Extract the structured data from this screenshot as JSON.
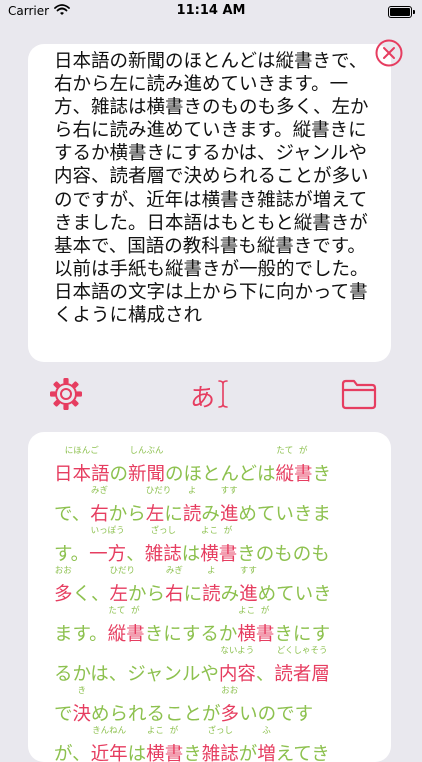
{
  "status_bar": {
    "carrier": "Carrier",
    "time": "11:14 AM"
  },
  "input": {
    "text": "日本語の新聞のほとんどは縦書きで、右から左に読み進めていきます。一方、雑誌は横書きのものも多く、左から右に読み進めていきます。縦書きにするか横書きにするかは、ジャンルや内容、読者層で決められることが多いのですが、近年は横書き雑誌が増えてきました。日本語はもともと縦書きが基本で、国語の教科書も縦書きです。以前は手紙も縦書きが一般的でした。日本語の文字は上から下に向かって書くように構成され"
  },
  "toolbar": {
    "mode_glyph": "あ"
  },
  "icons": {
    "close": "close-circle-icon",
    "settings": "gear-icon",
    "mode": "hiragana-text-cursor-icon",
    "files": "folder-icon"
  },
  "colors": {
    "accent": "#e63d60",
    "kana": "#8dc14f",
    "background": "#e9e8ee"
  },
  "output": {
    "lines": [
      [
        {
          "t": "日本語",
          "r": "にほんご"
        },
        {
          "t": "の"
        },
        {
          "t": "新聞",
          "r": "しんぶん"
        },
        {
          "t": "のほとんどは"
        },
        {
          "t": "縦",
          "r": "たて"
        },
        {
          "t": "書",
          "r": "が"
        },
        {
          "t": "き"
        }
      ],
      [
        {
          "t": "で、"
        },
        {
          "t": "右",
          "r": "みぎ"
        },
        {
          "t": "から"
        },
        {
          "t": "左",
          "r": "ひだり"
        },
        {
          "t": "に"
        },
        {
          "t": "読",
          "r": "よ"
        },
        {
          "t": "み"
        },
        {
          "t": "進",
          "r": "すす"
        },
        {
          "t": "めていきま"
        }
      ],
      [
        {
          "t": "す。"
        },
        {
          "t": "一方",
          "r": "いっぽう"
        },
        {
          "t": "、"
        },
        {
          "t": "雑誌",
          "r": "ざっし"
        },
        {
          "t": "は"
        },
        {
          "t": "横",
          "r": "よこ"
        },
        {
          "t": "書",
          "r": "が"
        },
        {
          "t": "きのものも"
        }
      ],
      [
        {
          "t": "多",
          "r": "おお"
        },
        {
          "t": "く、"
        },
        {
          "t": "左",
          "r": "ひだり"
        },
        {
          "t": "から"
        },
        {
          "t": "右",
          "r": "みぎ"
        },
        {
          "t": "に"
        },
        {
          "t": "読",
          "r": "よ"
        },
        {
          "t": "み"
        },
        {
          "t": "進",
          "r": "すす"
        },
        {
          "t": "めていき"
        }
      ],
      [
        {
          "t": "ます。"
        },
        {
          "t": "縦",
          "r": "たて"
        },
        {
          "t": "書",
          "r": "が"
        },
        {
          "t": "きにするか"
        },
        {
          "t": "横",
          "r": "よこ"
        },
        {
          "t": "書",
          "r": "が"
        },
        {
          "t": "きにす"
        }
      ],
      [
        {
          "t": "るかは、ジャンルや"
        },
        {
          "t": "内容",
          "r": "ないよう"
        },
        {
          "t": "、"
        },
        {
          "t": "読者層",
          "r": "どくしゃそう"
        }
      ],
      [
        {
          "t": "で"
        },
        {
          "t": "決",
          "r": "き"
        },
        {
          "t": "められることが"
        },
        {
          "t": "多",
          "r": "おお"
        },
        {
          "t": "いのです"
        }
      ],
      [
        {
          "t": "が、"
        },
        {
          "t": "近年",
          "r": "きんねん"
        },
        {
          "t": "は"
        },
        {
          "t": "横",
          "r": "よこ"
        },
        {
          "t": "書",
          "r": "が"
        },
        {
          "t": "き"
        },
        {
          "t": "雑誌",
          "r": "ざっし"
        },
        {
          "t": "が"
        },
        {
          "t": "増",
          "r": "ふ"
        },
        {
          "t": "えてき"
        }
      ]
    ]
  }
}
